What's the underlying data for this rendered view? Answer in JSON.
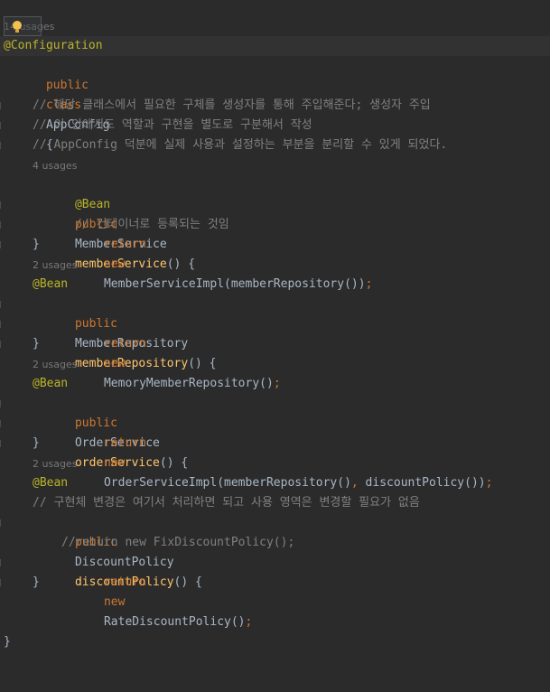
{
  "intention_hint": "lightbulb-icon",
  "lines": {
    "l01": {
      "hint": "14 usages"
    },
    "l02": {
      "annotation": "@Configuration"
    },
    "l03": {
      "kw1": "public",
      "kw2": "class",
      "name": "AppConfig",
      "brace": "{"
    },
    "l05": {
      "comment": "// 해당 클래스에서 필요한 구체를 생성자를 통해 주입해준다; 생성자 주입"
    },
    "l06": {
      "comment": "// 이 안에서도 역할과 구현을 별도로 구분해서 작성"
    },
    "l07": {
      "comment": "// AppConfig 덕분에 실제 사용과 설정하는 부분을 분리할 수 있게 되었다."
    },
    "l08": {
      "hint": "4 usages"
    },
    "l09": {
      "annotation": "@Bean",
      "comment": "// 컨테이너로 등록되는 것임"
    },
    "l10": {
      "kw": "public",
      "type": "MemberService",
      "method": "memberService",
      "rest": "() {"
    },
    "l11": {
      "kw1": "return",
      "kw2": "new",
      "call": "MemberServiceImpl(memberRepository())",
      "semi": ";"
    },
    "l12": {
      "brace": "}"
    },
    "l13": {
      "hint": "2 usages"
    },
    "l14": {
      "annotation": "@Bean"
    },
    "l15": {
      "kw": "public",
      "type": "MemberRepository",
      "method": "memberRepository",
      "rest": "() {"
    },
    "l16": {
      "kw1": "return",
      "kw2": "new",
      "call": "MemoryMemberRepository()",
      "semi": ";"
    },
    "l17": {
      "brace": "}"
    },
    "l18": {
      "hint": "2 usages"
    },
    "l19": {
      "annotation": "@Bean"
    },
    "l20": {
      "kw": "public",
      "type": "OrderService",
      "method": "orderService",
      "rest": "() {"
    },
    "l21": {
      "kw1": "return",
      "kw2": "new",
      "call1": "OrderServiceImpl(memberRepository()",
      "comma": ",",
      "call2": " discountPolicy())",
      "semi": ";"
    },
    "l22": {
      "brace": "}"
    },
    "l23": {
      "hint": "2 usages"
    },
    "l24": {
      "annotation": "@Bean"
    },
    "l25": {
      "comment": "// 구현체 변경은 여기서 처리하면 되고 사용 영역은 변경할 필요가 없음"
    },
    "l26": {
      "kw": "public",
      "type": "DiscountPolicy",
      "method": "discountPolicy",
      "rest": "() {"
    },
    "l27": {
      "comment": "//return new FixDiscountPolicy();"
    },
    "l28": {
      "kw1": "return",
      "kw2": "new",
      "call": "RateDiscountPolicy()",
      "semi": ";"
    },
    "l29": {
      "brace": "}"
    },
    "l32": {
      "brace": "}"
    }
  }
}
